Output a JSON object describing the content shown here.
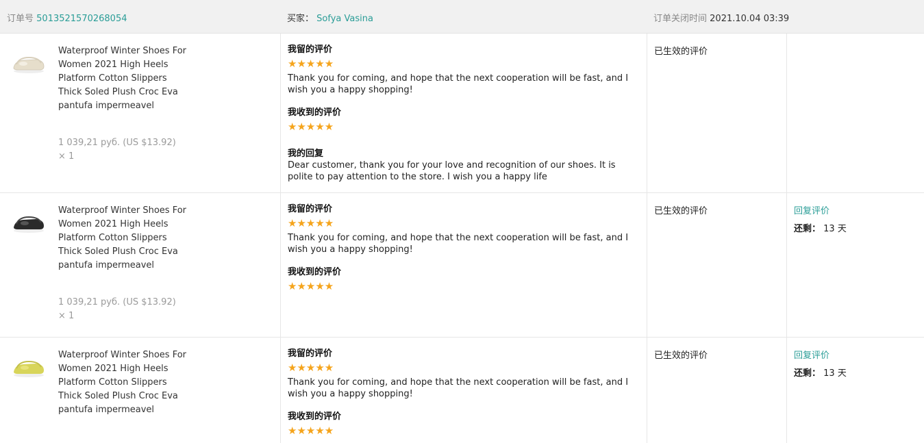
{
  "header": {
    "order_label": "订单号",
    "order_number": "5013521570268054",
    "buyer_label": "买家：",
    "buyer_name": "Sofya Vasina",
    "close_time_label": "订单关闭时间",
    "close_time": "2021.10.04 03:39"
  },
  "colors": {
    "accent": "#2a9d97",
    "star": "#f5a41c",
    "header_bg": "#f1f1f1"
  },
  "rows": [
    {
      "product": {
        "title": "Waterproof Winter Shoes For Women 2021 High Heels Platform Cotton Slippers Thick Soled Plush Croc Eva pantufa impermeavel",
        "price": "1 039,21 руб. (US $13.92)",
        "qty": "× 1",
        "image_icon": "beige-clog-icon",
        "image_color": "#e8e0cf"
      },
      "review": {
        "given_label": "我留的评价",
        "given_stars": "★★★★★",
        "given_rating": 5,
        "given_text": "Thank you for coming, and hope that the next cooperation will be fast, and I wish you a happy shopping!",
        "received_label": "我收到的评价",
        "received_stars": "★★★★★",
        "received_rating": 5,
        "reply_label": "我的回复",
        "reply_text": "Dear customer, thank you for your love and recognition of our shoes. It is polite to pay attention to the store. I wish you a happy life"
      },
      "status": "已生效的评价"
    },
    {
      "product": {
        "title": "Waterproof Winter Shoes For Women 2021 High Heels Platform Cotton Slippers Thick Soled Plush Croc Eva pantufa impermeavel",
        "price": "1 039,21 руб. (US $13.92)",
        "qty": "× 1",
        "image_icon": "black-clog-icon",
        "image_color": "#2b2b2b"
      },
      "review": {
        "given_label": "我留的评价",
        "given_stars": "★★★★★",
        "given_rating": 5,
        "given_text": "Thank you for coming, and hope that the next cooperation will be fast, and I wish you a happy shopping!",
        "received_label": "我收到的评价",
        "received_stars": "★★★★★",
        "received_rating": 5
      },
      "status": "已生效的评价",
      "action": {
        "reply_link": "回复评价",
        "remain_label": "还剩：",
        "remain_value": "13 天"
      }
    },
    {
      "product": {
        "title": "Waterproof Winter Shoes For Women 2021 High Heels Platform Cotton Slippers Thick Soled Plush Croc Eva pantufa impermeavel",
        "price": "",
        "qty": "",
        "image_icon": "yellow-clog-icon",
        "image_color": "#d8d55a"
      },
      "review": {
        "given_label": "我留的评价",
        "given_stars": "★★★★★",
        "given_rating": 5,
        "given_text": "Thank you for coming, and hope that the next cooperation will be fast, and I wish you a happy shopping!",
        "received_label": "我收到的评价",
        "received_stars": "★★★★★",
        "received_rating": 5
      },
      "status": "已生效的评价",
      "action": {
        "reply_link": "回复评价",
        "remain_label": "还剩：",
        "remain_value": "13 天"
      }
    }
  ]
}
